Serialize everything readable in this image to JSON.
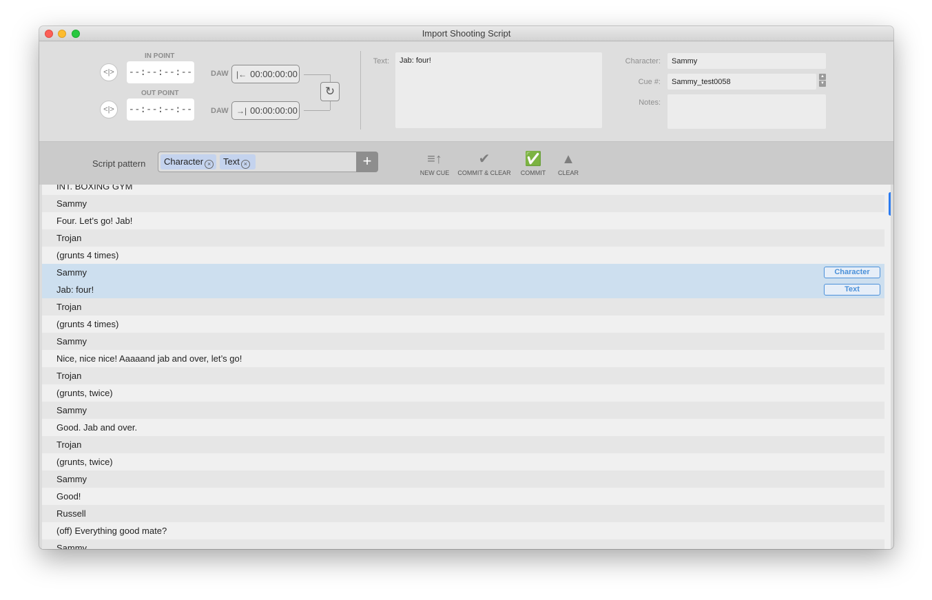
{
  "window": {
    "title": "Import Shooting Script"
  },
  "timecode": {
    "in_point_label": "IN POINT",
    "out_point_label": "OUT POINT",
    "in_value": "--:--:--:--",
    "out_value": "--:--:--:--",
    "daw_label": "DAW",
    "daw_in_value": "00:00:00:00",
    "daw_out_value": "00:00:00:00"
  },
  "cue": {
    "text_label": "Text:",
    "text_value": "Jab: four!",
    "character_label": "Character:",
    "character_value": "Sammy",
    "cue_label": "Cue #:",
    "cue_value": "Sammy_test0058",
    "notes_label": "Notes:",
    "notes_value": ""
  },
  "toolbar": {
    "script_pattern_label": "Script pattern",
    "tokens": [
      "Character",
      "Text"
    ],
    "add_label": "+",
    "new_cue": "NEW CUE",
    "commit_clear": "COMMIT & CLEAR",
    "commit": "COMMIT",
    "clear": "CLEAR"
  },
  "script_rows": [
    {
      "text": "INT. BOXING GYM"
    },
    {
      "text": "Sammy"
    },
    {
      "text": "Four. Let’s go! Jab!"
    },
    {
      "text": "Trojan"
    },
    {
      "text": "(grunts 4 times)"
    },
    {
      "text": "Sammy",
      "selected": true,
      "tag": "Character"
    },
    {
      "text": "Jab: four!",
      "selected": true,
      "tag": "Text"
    },
    {
      "text": "Trojan"
    },
    {
      "text": "(grunts 4 times)"
    },
    {
      "text": "Sammy"
    },
    {
      "text": "Nice, nice nice! Aaaaand jab and over, let’s go!"
    },
    {
      "text": "Trojan"
    },
    {
      "text": "(grunts, twice)"
    },
    {
      "text": "Sammy"
    },
    {
      "text": "Good. Jab and over."
    },
    {
      "text": "Trojan"
    },
    {
      "text": "(grunts, twice)"
    },
    {
      "text": "Sammy"
    },
    {
      "text": "Good!"
    },
    {
      "text": "Russell"
    },
    {
      "text": "(off) Everything good mate?"
    },
    {
      "text": "Sammy"
    }
  ],
  "colors": {
    "selection": "#cddfef",
    "tag_accent": "#4a90d9",
    "scroll_thumb": "#2b7bf0"
  }
}
